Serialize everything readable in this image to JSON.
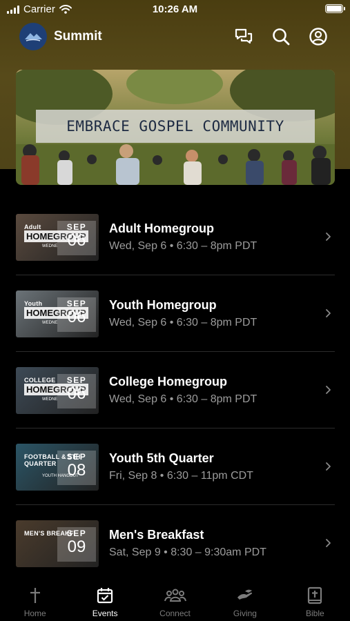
{
  "status": {
    "carrier": "Carrier",
    "time": "10:26 AM"
  },
  "header": {
    "title": "Summit"
  },
  "banner": {
    "text": "EMBRACE GOSPEL COMMUNITY"
  },
  "events": [
    {
      "title": "Adult Homegroup",
      "subtitle": "Wed, Sep 6 • 6:30 – 8pm PDT",
      "thumb_tag": "Adult",
      "thumb_kind": "HOMEGROUP",
      "thumb_week": "WEDNE",
      "month": "SEP",
      "day": "06",
      "thumb_color": "#5a4a3e"
    },
    {
      "title": "Youth Homegroup",
      "subtitle": "Wed, Sep 6 • 6:30 – 8pm PDT",
      "thumb_tag": "Youth",
      "thumb_kind": "HOMEGROUP",
      "thumb_week": "WEDNE",
      "month": "SEP",
      "day": "06",
      "thumb_color": "#6b7378"
    },
    {
      "title": "College Homegroup",
      "subtitle": "Wed, Sep 6 • 6:30 – 8pm PDT",
      "thumb_tag": "COLLEGE",
      "thumb_kind": "HOMEGROUP",
      "thumb_week": "WEDNE",
      "month": "SEP",
      "day": "06",
      "thumb_color": "#3d4a56"
    },
    {
      "title": "Youth 5th Quarter",
      "subtitle": "Fri, Sep 8 • 6:30 – 11pm CDT",
      "thumb_tag": "FOOTBALL & 5TH QUARTER",
      "thumb_kind": "",
      "thumb_week": "YOUTH HANGOUT",
      "month": "SEP",
      "day": "08",
      "thumb_color": "#2b5566"
    },
    {
      "title": "Men's Breakfast",
      "subtitle": "Sat, Sep 9 • 8:30 – 9:30am PDT",
      "thumb_tag": "MEN'S BREAKF",
      "thumb_kind": "",
      "thumb_week": "",
      "month": "SEP",
      "day": "09",
      "thumb_color": "#4a3b2c"
    }
  ],
  "tabs": [
    {
      "label": "Home",
      "icon": "cross-icon",
      "active": false
    },
    {
      "label": "Events",
      "icon": "calendar-check-icon",
      "active": true
    },
    {
      "label": "Connect",
      "icon": "people-group-icon",
      "active": false
    },
    {
      "label": "Giving",
      "icon": "giving-hand-icon",
      "active": false
    },
    {
      "label": "Bible",
      "icon": "bible-icon",
      "active": false
    }
  ],
  "colors": {
    "header_bg": "#574a1a",
    "background": "#000000",
    "muted_text": "#9c9c9c",
    "tab_inactive": "#7c7c7c"
  }
}
